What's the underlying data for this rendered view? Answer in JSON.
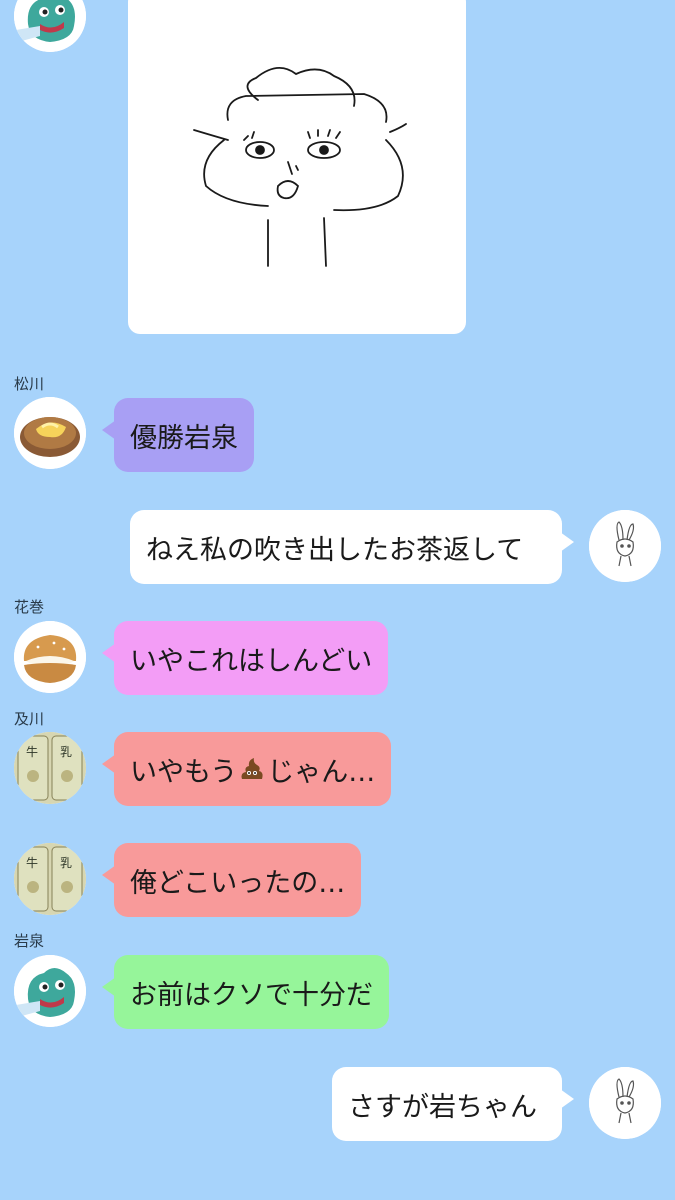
{
  "messages": [
    {
      "sender": "松川",
      "text": "優勝岩泉",
      "bubble_color": "#a89ff4"
    },
    {
      "sender": "me",
      "text": "ねえ私の吹き出したお茶返して",
      "bubble_color": "#ffffff"
    },
    {
      "sender": "花巻",
      "text": "いやこれはしんどい",
      "bubble_color": "#f39df6"
    },
    {
      "sender": "及川",
      "text_before": "いやもう",
      "emoji": "poop-emoji",
      "text_after": "じゃん…",
      "bubble_color": "#f89a9a"
    },
    {
      "sender": "及川",
      "text": "俺どこいったの…",
      "bubble_color": "#f89a9a"
    },
    {
      "sender": "岩泉",
      "text": "お前はクソで十分だ",
      "bubble_color": "#96f59a"
    },
    {
      "sender": "me",
      "text": "さすが岩ちゃん",
      "bubble_color": "#ffffff"
    }
  ],
  "avatars": {
    "matsukawa": "potato-cake-icon",
    "hanamaki": "cream-puff-icon",
    "oikawa": "milk-bread-icon",
    "iwaizumi": "green-monster-icon",
    "me": "bunny-sketch-icon"
  },
  "drawing": "sketch-image"
}
